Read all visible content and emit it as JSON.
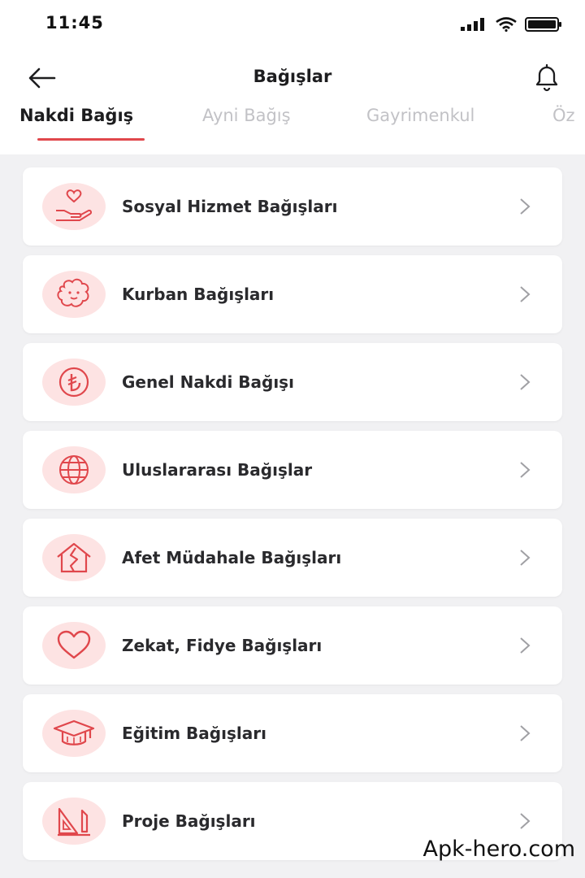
{
  "status_bar": {
    "time": "11:45"
  },
  "header": {
    "title": "Bağışlar"
  },
  "tabs": [
    {
      "label": "Nakdi Bağış",
      "active": true
    },
    {
      "label": "Ayni Bağış",
      "active": false
    },
    {
      "label": "Gayrimenkul",
      "active": false
    },
    {
      "label": "Öz",
      "active": false
    }
  ],
  "items": [
    {
      "label": "Sosyal Hizmet Bağışları",
      "icon": "hand-heart-icon"
    },
    {
      "label": "Kurban Bağışları",
      "icon": "sheep-icon"
    },
    {
      "label": "Genel Nakdi Bağışı",
      "icon": "lira-icon"
    },
    {
      "label": "Uluslararası Bağışlar",
      "icon": "globe-icon"
    },
    {
      "label": "Afet Müdahale Bağışları",
      "icon": "cracked-house-icon"
    },
    {
      "label": "Zekat, Fidye Bağışları",
      "icon": "heart-icon"
    },
    {
      "label": "Eğitim Bağışları",
      "icon": "graduation-cap-icon"
    },
    {
      "label": "Proje Bağışları",
      "icon": "drafting-tools-icon"
    }
  ],
  "watermark": "Apk-hero.com",
  "colors": {
    "accent": "#e0474c",
    "icon_bg": "#fde3e3"
  }
}
